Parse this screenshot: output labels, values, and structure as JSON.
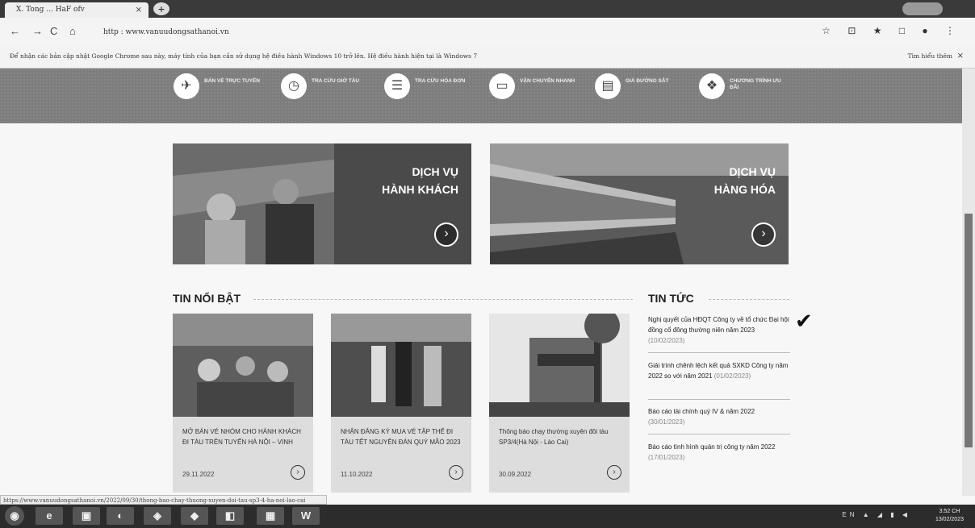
{
  "browser": {
    "tab_title": "X. Tong ... HaF ofv",
    "tab_close": "×",
    "new_tab": "+",
    "nav": {
      "back": "←",
      "forward": "→",
      "reload": "C",
      "home": "⌂"
    },
    "url": "http : www.vanuudongsathanoi.vn",
    "toolbar_icons": "☆ ⊡ ★ □ ● ⋮"
  },
  "infobar": {
    "message": "Để nhận các bản cập nhật Google Chrome sau này, máy tính của bạn cần sử dụng hệ điều hành Windows 10 trở lên. Hệ điều hành hiện tại là Windows 7",
    "link": "Tìm hiểu thêm",
    "close": "×"
  },
  "services": [
    {
      "label": "BÁN VÉ TRỰC TUYẾN",
      "icon": "✈"
    },
    {
      "label": "TRA CỨU GIỜ TÀU",
      "icon": "◷"
    },
    {
      "label": "TRA CỨU HÓA ĐƠN",
      "icon": "☰"
    },
    {
      "label": "VẬN CHUYỂN NHANH",
      "icon": "▭"
    },
    {
      "label": "GIÁ ĐƯỜNG SẮT",
      "icon": "▤"
    },
    {
      "label": "CHƯƠNG TRÌNH ƯU ĐÃI",
      "icon": "❖"
    }
  ],
  "heroes": [
    {
      "line1": "DỊCH VỤ",
      "line2": "HÀNH KHÁCH",
      "button": "›"
    },
    {
      "line1": "DỊCH VỤ",
      "line2": "HÀNG HÓA",
      "button": "›"
    }
  ],
  "featured_title": "TIN NỔI BẬT",
  "featured": [
    {
      "title": "MỞ BÁN VÉ NHÓM CHO HÀNH KHÁCH ĐI TÀU TRÊN TUYẾN HÀ NỘI – VINH",
      "date": "29.11.2022",
      "go": "›"
    },
    {
      "title": "NHẬN ĐĂNG KÝ MUA VÉ TẬP THỂ ĐI TÀU TẾT NGUYÊN ĐÁN QUÝ MÃO 2023",
      "date": "11.10.2022",
      "go": "›"
    },
    {
      "title": "Thông báo chạy thường xuyên đôi tàu SP3/4(Hà Nội - Lào Cai)",
      "date": "30.09.2022",
      "go": "›"
    }
  ],
  "news_title": "TIN TỨC",
  "news": [
    {
      "text": "Nghị quyết của HĐQT Công ty về tổ chức Đại hội đồng cổ đông thường niên năm 2023",
      "date": "(10/02/2023)"
    },
    {
      "text": "Giải trình chênh lệch kết quả SXKD Công ty năm 2022 so với năm 2021",
      "date": "(01/02/2023)"
    },
    {
      "text": "Báo cáo tài chính quý IV & năm 2022",
      "date": "(30/01/2023)"
    },
    {
      "text": "Báo cáo tình hình quản trị công ty năm 2022",
      "date": "(17/01/2023)"
    }
  ],
  "check_mark": "✔",
  "status_url": "https://www.vanuudongsathanoi.vn/2022/09/30/thong-bao-chay-thuong-xuyen-doi-tau-sp3-4-ha-noi-lao-cai",
  "taskbar": {
    "start": "◉",
    "apps": [
      "e",
      "▣",
      "◐",
      "◈",
      "◆",
      "◧",
      "▦",
      "W"
    ],
    "tray": "EN ▲ ◢ ▮ ◀",
    "time": "3:52 CH",
    "date": "13/02/2023"
  }
}
